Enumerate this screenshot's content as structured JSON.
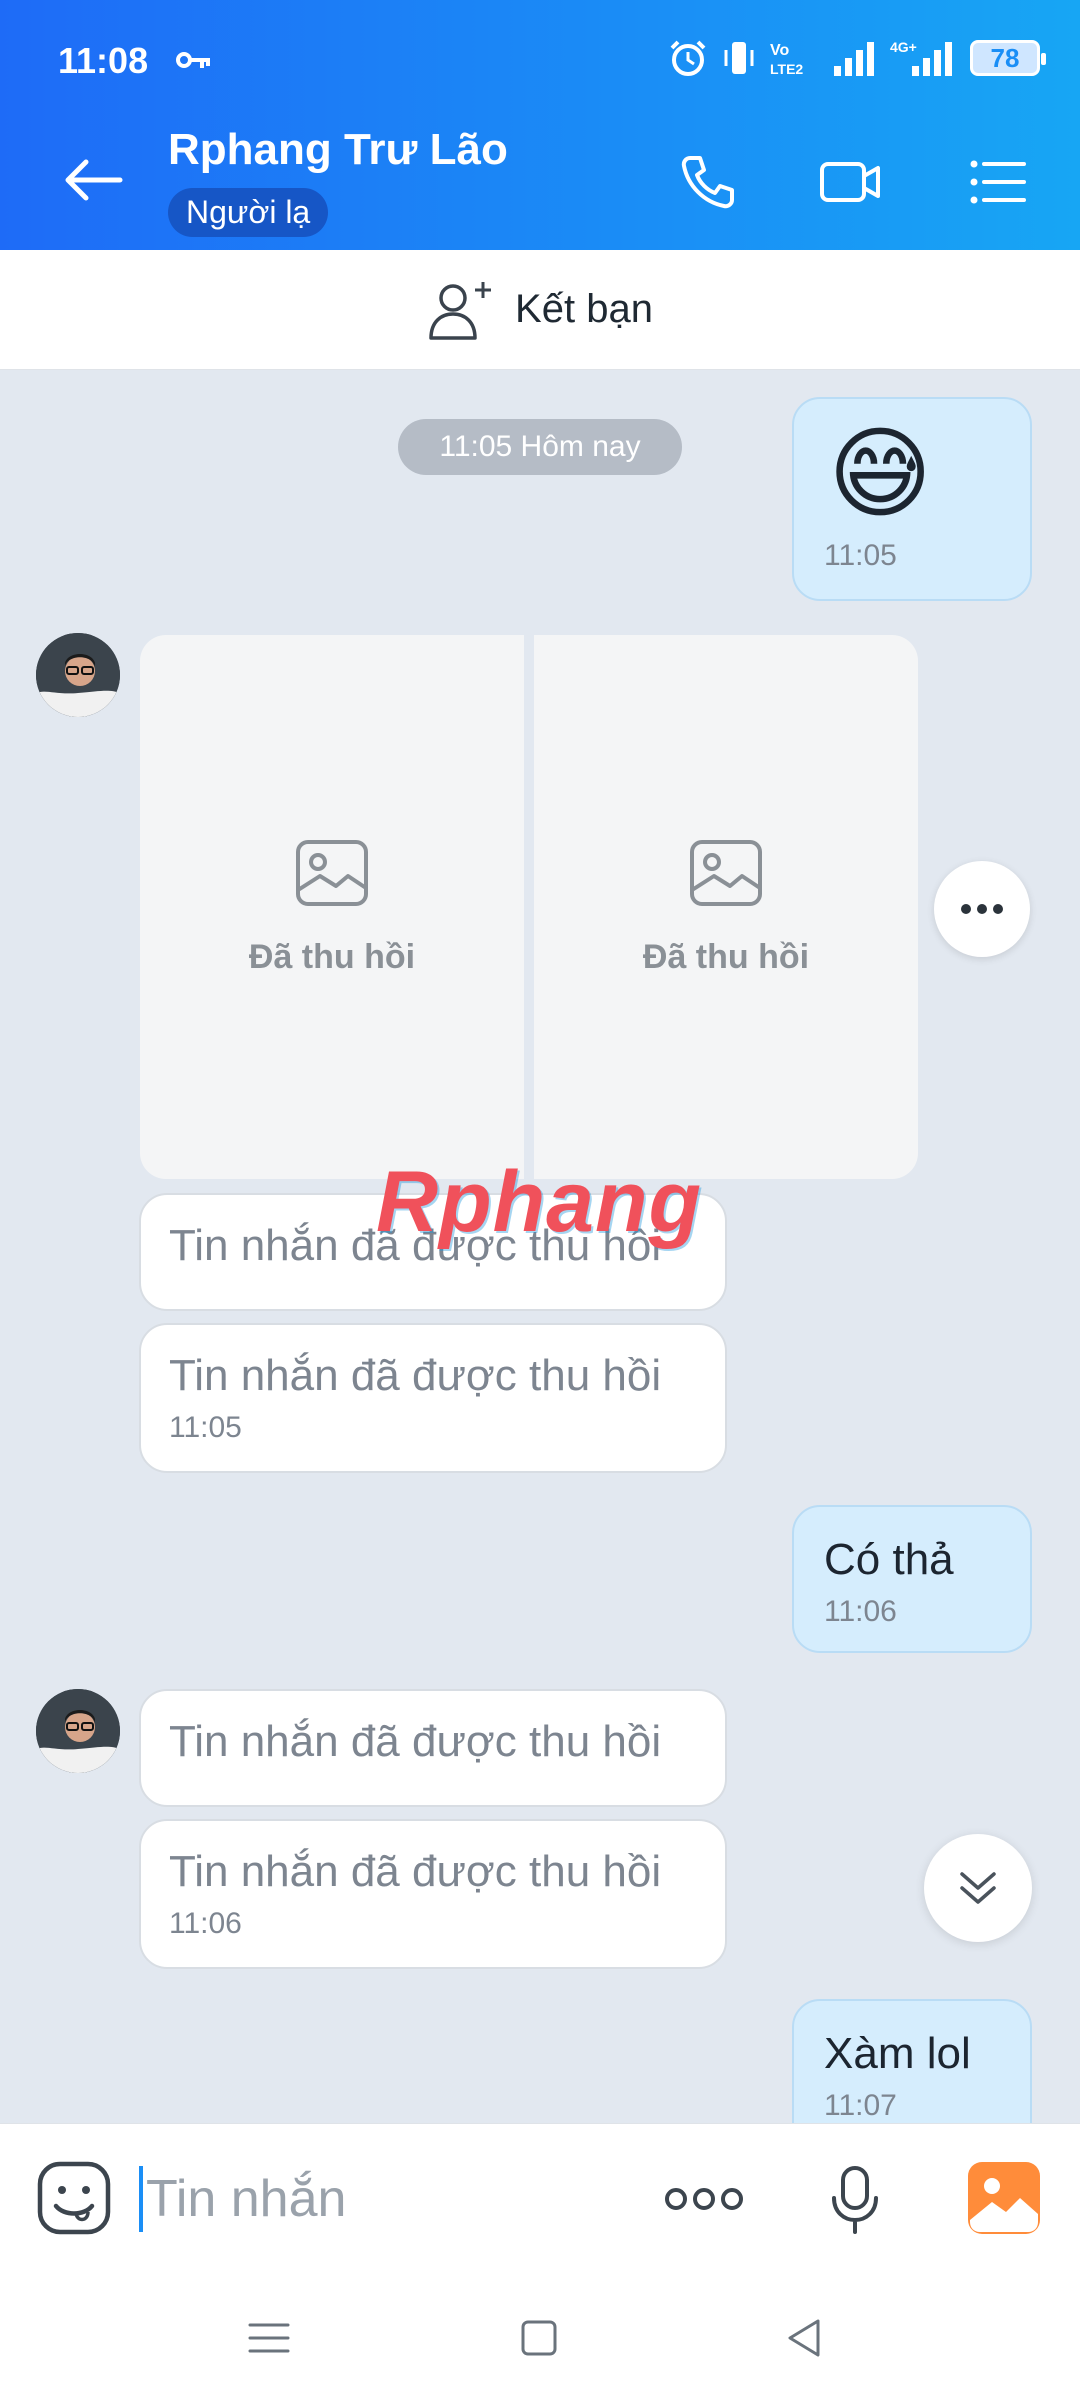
{
  "status_bar": {
    "time": "11:08",
    "battery": "78",
    "network": "4G+"
  },
  "header": {
    "title": "Rphang Trư Lão",
    "badge": "Người lạ"
  },
  "friend_bar": {
    "label": "Kết bạn"
  },
  "chat": {
    "timestamp_pill": "11:05 Hôm nay",
    "msg_emoji": {
      "emoji": "😅",
      "time": "11:05"
    },
    "recalled_images": [
      "Đã thu hồi",
      "Đã thu hồi"
    ],
    "recalled_1": {
      "text": "Tin nhắn đã được thu hồi"
    },
    "recalled_2": {
      "text": "Tin nhắn đã được thu hồi",
      "time": "11:05"
    },
    "msg_co_tha": {
      "text": "Có thả",
      "time": "11:06"
    },
    "recalled_3": {
      "text": "Tin nhắn đã được thu hồi"
    },
    "recalled_4": {
      "text": "Tin nhắn đã được thu hồi",
      "time": "11:06"
    },
    "msg_xam": {
      "text": "Xàm lol",
      "time": "11:07"
    },
    "watermark": "Rphang"
  },
  "input_bar": {
    "placeholder": "Tin nhắn"
  },
  "colors": {
    "header": "#1e6bf7",
    "outgoing": "#d5edfd",
    "background": "#e2e8f0"
  }
}
